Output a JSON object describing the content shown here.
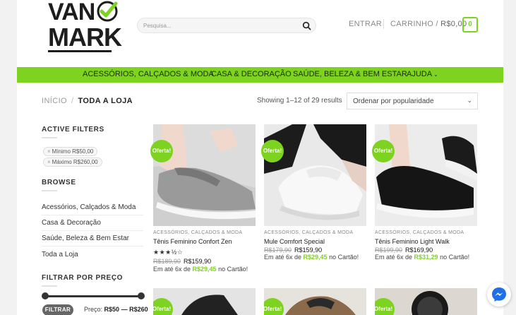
{
  "logo": {
    "line1": "VAN",
    "line2": "MARK"
  },
  "search": {
    "placeholder": "Pesquisa..."
  },
  "header": {
    "login": "ENTRAR",
    "cart_label": "CARRINHO / ",
    "cart_total": "R$0,00",
    "cart_count": "0"
  },
  "menu": [
    {
      "label": "ACESSÓRIOS, CALÇADOS & MODA"
    },
    {
      "label": "CASA & DECORAÇÃO"
    },
    {
      "label": "SAÚDE, BELEZA & BEM ESTAR"
    },
    {
      "label": "AJUDA"
    }
  ],
  "breadcrumb": {
    "home": "INÍCIO",
    "separator": "/",
    "current": "TODA A LOJA"
  },
  "results": {
    "text": "Showing 1–12 of 29 results"
  },
  "sort": {
    "selected": "Ordenar por popularidade"
  },
  "sidebar": {
    "active_filters_title": "ACTIVE FILTERS",
    "filters": [
      {
        "label": "Mínimo R$50,00"
      },
      {
        "label": "Máximo R$260,00"
      }
    ],
    "browse_title": "BROWSE",
    "categories": [
      {
        "label": "Acessórios, Calçados & Moda"
      },
      {
        "label": "Casa & Decoração"
      },
      {
        "label": "Saúde, Beleza & Bem Estar"
      },
      {
        "label": "Toda a Loja"
      }
    ],
    "price_filter_title": "FILTRAR POR PREÇO",
    "filter_button": "FILTRAR",
    "price_label": "Preço:",
    "price_min": "R$50",
    "price_dash": "—",
    "price_max": "R$260"
  },
  "products": [
    {
      "badge": "Oferta!",
      "category": "ACESSÓRIOS, CALÇADOS & MODA",
      "name": "Tênis Feminino Confort Zen",
      "rating": "★★★½☆",
      "old_price": "R$189,90",
      "price": "R$159,90",
      "installment_prefix": "Em até 6x de ",
      "installment_value": "R$29,45",
      "installment_suffix": " no Cartão!"
    },
    {
      "badge": "Oferta!",
      "category": "ACESSÓRIOS, CALÇADOS & MODA",
      "name": "Mule Comfort Special",
      "old_price": "R$179,90",
      "price": "R$159,90",
      "installment_prefix": "Em até 6x de ",
      "installment_value": "R$29,45",
      "installment_suffix": " no Cartão!"
    },
    {
      "badge": "Oferta!",
      "category": "ACESSÓRIOS, CALÇADOS & MODA",
      "name": "Tênis Feminino Light Walk",
      "old_price": "R$199,90",
      "price": "R$169,90",
      "installment_prefix": "Em até 6x de ",
      "installment_value": "R$31,29",
      "installment_suffix": " no Cartão!"
    }
  ],
  "bottom_row_badges": [
    "Oferta!",
    "Oferta!",
    "Oferta!"
  ],
  "colors": {
    "accent": "#7ed321",
    "text": "#333333"
  },
  "icons": [
    "search-icon",
    "checkmark-logo-icon",
    "chevron-down-icon",
    "messenger-icon"
  ]
}
